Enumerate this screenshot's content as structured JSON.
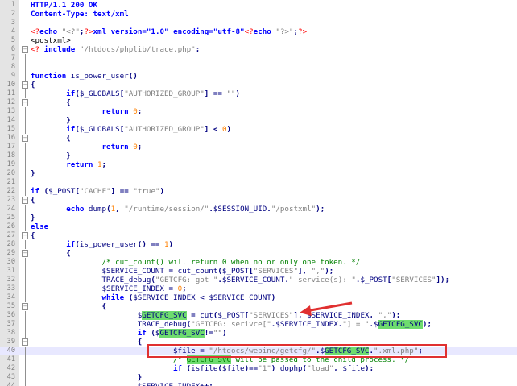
{
  "editor": {
    "lines": [
      {
        "n": "1",
        "segs": [
          [
            "HTTP/1.1 200 OK",
            "kw"
          ]
        ]
      },
      {
        "n": "2",
        "segs": [
          [
            "Content-Type: text/xml",
            "kw"
          ]
        ]
      },
      {
        "n": "3",
        "segs": []
      },
      {
        "n": "4",
        "segs": [
          [
            "<?",
            "php"
          ],
          [
            "echo ",
            "kw"
          ],
          [
            "\"<?\"",
            "str"
          ],
          [
            ";",
            "op"
          ],
          [
            "?>",
            "php"
          ],
          [
            "xml version=\"1.0\" encoding=\"utf-8\"",
            "kw"
          ],
          [
            "<?",
            "php"
          ],
          [
            "echo ",
            "kw"
          ],
          [
            "\"?>\"",
            "str"
          ],
          [
            ";",
            "op"
          ],
          [
            "?>",
            "php"
          ]
        ]
      },
      {
        "n": "5",
        "segs": [
          [
            "<postxml>",
            ""
          ]
        ]
      },
      {
        "n": "6",
        "segs": [
          [
            "<? ",
            "php"
          ],
          [
            "include ",
            "kw"
          ],
          [
            "\"/htdocs/phplib/trace.php\"",
            "str"
          ],
          [
            ";",
            "op"
          ]
        ]
      },
      {
        "n": "7",
        "segs": []
      },
      {
        "n": "8",
        "segs": []
      },
      {
        "n": "9",
        "segs": [
          [
            "function ",
            "kw"
          ],
          [
            "is_power_user",
            "var"
          ],
          [
            "()",
            "op"
          ]
        ]
      },
      {
        "n": "10",
        "segs": [
          [
            "{",
            "op"
          ]
        ]
      },
      {
        "n": "11",
        "segs": [
          [
            "        if",
            "kw"
          ],
          [
            "(",
            "op"
          ],
          [
            "$_GLOBALS",
            "var"
          ],
          [
            "[",
            "op"
          ],
          [
            "\"AUTHORIZED_GROUP\"",
            "str"
          ],
          [
            "] == ",
            "op"
          ],
          [
            "\"\"",
            "str"
          ],
          [
            ")",
            "op"
          ]
        ]
      },
      {
        "n": "12",
        "segs": [
          [
            "        {",
            "op"
          ]
        ]
      },
      {
        "n": "13",
        "segs": [
          [
            "                return ",
            "kw"
          ],
          [
            "0",
            "num"
          ],
          [
            ";",
            "op"
          ]
        ]
      },
      {
        "n": "14",
        "segs": [
          [
            "        }",
            "op"
          ]
        ]
      },
      {
        "n": "15",
        "segs": [
          [
            "        if",
            "kw"
          ],
          [
            "(",
            "op"
          ],
          [
            "$_GLOBALS",
            "var"
          ],
          [
            "[",
            "op"
          ],
          [
            "\"AUTHORIZED_GROUP\"",
            "str"
          ],
          [
            "] < ",
            "op"
          ],
          [
            "0",
            "num"
          ],
          [
            ")",
            "op"
          ]
        ]
      },
      {
        "n": "16",
        "segs": [
          [
            "        {",
            "op"
          ]
        ]
      },
      {
        "n": "17",
        "segs": [
          [
            "                return ",
            "kw"
          ],
          [
            "0",
            "num"
          ],
          [
            ";",
            "op"
          ]
        ]
      },
      {
        "n": "18",
        "segs": [
          [
            "        }",
            "op"
          ]
        ]
      },
      {
        "n": "19",
        "segs": [
          [
            "        return ",
            "kw"
          ],
          [
            "1",
            "num"
          ],
          [
            ";",
            "op"
          ]
        ]
      },
      {
        "n": "20",
        "segs": [
          [
            "}",
            "op"
          ]
        ]
      },
      {
        "n": "21",
        "segs": []
      },
      {
        "n": "22",
        "segs": [
          [
            "if ",
            "kw"
          ],
          [
            "(",
            "op"
          ],
          [
            "$_POST",
            "var"
          ],
          [
            "[",
            "op"
          ],
          [
            "\"CACHE\"",
            "str"
          ],
          [
            "] == ",
            "op"
          ],
          [
            "\"true\"",
            "str"
          ],
          [
            ")",
            "op"
          ]
        ]
      },
      {
        "n": "23",
        "segs": [
          [
            "{",
            "op"
          ]
        ]
      },
      {
        "n": "24",
        "segs": [
          [
            "        echo ",
            "kw"
          ],
          [
            "dump",
            "var"
          ],
          [
            "(",
            "op"
          ],
          [
            "1",
            "num"
          ],
          [
            ", ",
            "op"
          ],
          [
            "\"/runtime/session/\"",
            "str"
          ],
          [
            ".",
            "op"
          ],
          [
            "$SESSION_UID",
            "var"
          ],
          [
            ".",
            "op"
          ],
          [
            "\"/postxml\"",
            "str"
          ],
          [
            ");",
            "op"
          ]
        ]
      },
      {
        "n": "25",
        "segs": [
          [
            "}",
            "op"
          ]
        ]
      },
      {
        "n": "26",
        "segs": [
          [
            "else",
            "kw"
          ]
        ]
      },
      {
        "n": "27",
        "segs": [
          [
            "{",
            "op"
          ]
        ]
      },
      {
        "n": "28",
        "segs": [
          [
            "        if",
            "kw"
          ],
          [
            "(",
            "op"
          ],
          [
            "is_power_user",
            "var"
          ],
          [
            "() == ",
            "op"
          ],
          [
            "1",
            "num"
          ],
          [
            ")",
            "op"
          ]
        ]
      },
      {
        "n": "29",
        "segs": [
          [
            "        {",
            "op"
          ]
        ]
      },
      {
        "n": "30",
        "segs": [
          [
            "                /* cut_count() will return 0 when no or only one token. */",
            "cm"
          ]
        ]
      },
      {
        "n": "31",
        "segs": [
          [
            "                $SERVICE_COUNT",
            "var"
          ],
          [
            " = ",
            "op"
          ],
          [
            "cut_count",
            "var"
          ],
          [
            "(",
            "op"
          ],
          [
            "$_POST",
            "var"
          ],
          [
            "[",
            "op"
          ],
          [
            "\"SERVICES\"",
            "str"
          ],
          [
            "], ",
            "op"
          ],
          [
            "\",\"",
            "str"
          ],
          [
            ");",
            "op"
          ]
        ]
      },
      {
        "n": "32",
        "segs": [
          [
            "                TRACE_debug",
            "var"
          ],
          [
            "(",
            "op"
          ],
          [
            "\"GETCFG: got \"",
            "str"
          ],
          [
            ".",
            "op"
          ],
          [
            "$SERVICE_COUNT",
            "var"
          ],
          [
            ".",
            "op"
          ],
          [
            "\" service(s): \"",
            "str"
          ],
          [
            ".",
            "op"
          ],
          [
            "$_POST",
            "var"
          ],
          [
            "[",
            "op"
          ],
          [
            "\"SERVICES\"",
            "str"
          ],
          [
            "]);",
            "op"
          ]
        ]
      },
      {
        "n": "33",
        "segs": [
          [
            "                $SERVICE_INDEX",
            "var"
          ],
          [
            " = ",
            "op"
          ],
          [
            "0",
            "num"
          ],
          [
            ";",
            "op"
          ]
        ]
      },
      {
        "n": "34",
        "segs": [
          [
            "                while ",
            "kw"
          ],
          [
            "(",
            "op"
          ],
          [
            "$SERVICE_INDEX",
            "var"
          ],
          [
            " < ",
            "op"
          ],
          [
            "$SERVICE_COUNT",
            "var"
          ],
          [
            ")",
            "op"
          ]
        ]
      },
      {
        "n": "35",
        "segs": [
          [
            "                {",
            "op"
          ]
        ]
      },
      {
        "n": "36",
        "segs": [
          [
            "                        $",
            "var"
          ],
          [
            "GETCFG_SVC",
            "var g"
          ],
          [
            " = ",
            "op"
          ],
          [
            "cut",
            "var"
          ],
          [
            "(",
            "op"
          ],
          [
            "$_POST",
            "var"
          ],
          [
            "[",
            "op"
          ],
          [
            "\"SERVICES\"",
            "str"
          ],
          [
            "], ",
            "op"
          ],
          [
            "$SERVICE_INDEX",
            "var"
          ],
          [
            ", ",
            "op"
          ],
          [
            "\",\"",
            "str"
          ],
          [
            ");",
            "op"
          ]
        ]
      },
      {
        "n": "37",
        "segs": [
          [
            "                        TRACE_debug",
            "var"
          ],
          [
            "(",
            "op"
          ],
          [
            "\"GETCFG: serivce[\"",
            "str"
          ],
          [
            ".",
            "op"
          ],
          [
            "$SERVICE_INDEX",
            "var"
          ],
          [
            ".",
            "op"
          ],
          [
            "\"] = \"",
            "str"
          ],
          [
            ".",
            "op"
          ],
          [
            "$",
            "var"
          ],
          [
            "GETCFG_SVC",
            "var g"
          ],
          [
            ");",
            "op"
          ]
        ]
      },
      {
        "n": "38",
        "segs": [
          [
            "                        if ",
            "kw"
          ],
          [
            "(",
            "op"
          ],
          [
            "$",
            "var"
          ],
          [
            "GETCFG_SVC",
            "var g"
          ],
          [
            "!=",
            "op"
          ],
          [
            "\"\"",
            "str"
          ],
          [
            ")",
            "op"
          ]
        ]
      },
      {
        "n": "39",
        "segs": [
          [
            "                        {",
            "op"
          ]
        ]
      },
      {
        "n": "40",
        "segs": [
          [
            "                                $file",
            "var"
          ],
          [
            " = ",
            "op"
          ],
          [
            "\"/htdocs/webinc/getcfg/\"",
            "str"
          ],
          [
            ".",
            "op"
          ],
          [
            "$",
            "var"
          ],
          [
            "GETCFG_SVC",
            "var g"
          ],
          [
            ".",
            "op"
          ],
          [
            "\".xml.php\"",
            "str"
          ],
          [
            ";",
            "op"
          ]
        ]
      },
      {
        "n": "41",
        "segs": [
          [
            "                                /* ",
            "cm"
          ],
          [
            "GETCFG_SVC",
            "cm g"
          ],
          [
            " will be passed to the child process. */",
            "cm"
          ]
        ]
      },
      {
        "n": "42",
        "segs": [
          [
            "                                if ",
            "kw"
          ],
          [
            "(",
            "op"
          ],
          [
            "isfile",
            "var"
          ],
          [
            "(",
            "op"
          ],
          [
            "$file",
            "var"
          ],
          [
            ")==",
            "op"
          ],
          [
            "\"1\"",
            "str"
          ],
          [
            ") ",
            "op"
          ],
          [
            "dophp",
            "var"
          ],
          [
            "(",
            "op"
          ],
          [
            "\"load\"",
            "str"
          ],
          [
            ", ",
            "op"
          ],
          [
            "$file",
            "var"
          ],
          [
            ");",
            "op"
          ]
        ]
      },
      {
        "n": "43",
        "segs": [
          [
            "                        }",
            "op"
          ]
        ]
      },
      {
        "n": "44",
        "segs": [
          [
            "                        $SERVICE_INDEX",
            "var"
          ],
          [
            "++;",
            "op"
          ]
        ]
      }
    ],
    "folds": {
      "6": "box",
      "9": "",
      "10": "box",
      "12": "box",
      "16": "box",
      "23": "box",
      "27": "box",
      "29": "box",
      "35": "box",
      "39": "box"
    },
    "highlight_line": "40",
    "accent_colors": {
      "highlight": "#6edc6e",
      "annotation": "#e03030"
    }
  }
}
